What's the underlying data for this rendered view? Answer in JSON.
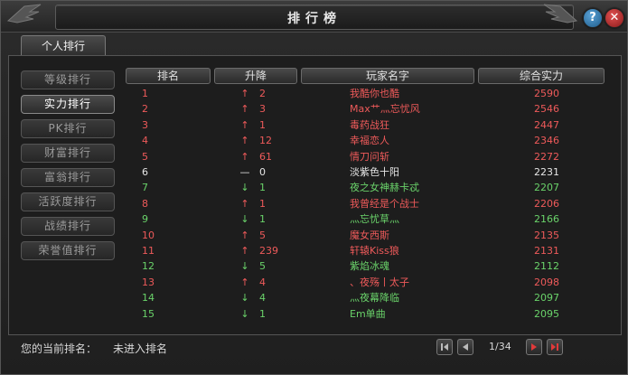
{
  "window": {
    "title": "排行榜"
  },
  "tabs": [
    {
      "label": "个人排行"
    }
  ],
  "menu": [
    {
      "label": "等级排行",
      "active": false
    },
    {
      "label": "实力排行",
      "active": true
    },
    {
      "label": "PK排行",
      "active": false
    },
    {
      "label": "财富排行",
      "active": false
    },
    {
      "label": "富翁排行",
      "active": false
    },
    {
      "label": "活跃度排行",
      "active": false
    },
    {
      "label": "战绩排行",
      "active": false
    },
    {
      "label": "荣誉值排行",
      "active": false
    }
  ],
  "table": {
    "columns": [
      "排名",
      "升降",
      "玩家名字",
      "综合实力"
    ],
    "rows": [
      {
        "rank": "1",
        "arrow": "↑",
        "change": "2",
        "name": "我酷你也酷",
        "power": "2590",
        "color": "red"
      },
      {
        "rank": "2",
        "arrow": "↑",
        "change": "3",
        "name": "Max艹灬忘忧风",
        "power": "2546",
        "color": "red"
      },
      {
        "rank": "3",
        "arrow": "↑",
        "change": "1",
        "name": "毒药战狂",
        "power": "2447",
        "color": "red"
      },
      {
        "rank": "4",
        "arrow": "↑",
        "change": "12",
        "name": "幸福恋人",
        "power": "2346",
        "color": "red"
      },
      {
        "rank": "5",
        "arrow": "↑",
        "change": "61",
        "name": "情刀问斩",
        "power": "2272",
        "color": "red"
      },
      {
        "rank": "6",
        "arrow": "—",
        "change": "0",
        "name": "淡紫色十阳",
        "power": "2231",
        "color": "white"
      },
      {
        "rank": "7",
        "arrow": "↓",
        "change": "1",
        "name": "夜之女神赫卡忒",
        "power": "2207",
        "color": "green"
      },
      {
        "rank": "8",
        "arrow": "↑",
        "change": "1",
        "name": "我曾经是个战士",
        "power": "2206",
        "color": "red"
      },
      {
        "rank": "9",
        "arrow": "↓",
        "change": "1",
        "name": "灬忘忧草灬",
        "power": "2166",
        "color": "green"
      },
      {
        "rank": "10",
        "arrow": "↑",
        "change": "5",
        "name": "魔女西斯",
        "power": "2135",
        "color": "red"
      },
      {
        "rank": "11",
        "arrow": "↑",
        "change": "239",
        "name": "轩辕Kiss狼",
        "power": "2131",
        "color": "red"
      },
      {
        "rank": "12",
        "arrow": "↓",
        "change": "5",
        "name": "紫焰冰魂",
        "power": "2112",
        "color": "green"
      },
      {
        "rank": "13",
        "arrow": "↑",
        "change": "4",
        "name": "、夜殇丨太子",
        "power": "2098",
        "color": "red"
      },
      {
        "rank": "14",
        "arrow": "↓",
        "change": "4",
        "name": "灬夜幕降临",
        "power": "2097",
        "color": "green"
      },
      {
        "rank": "15",
        "arrow": "↓",
        "change": "1",
        "name": "Em单曲",
        "power": "2095",
        "color": "green"
      }
    ]
  },
  "footer": {
    "my_rank_label": "您的当前排名：",
    "my_rank_value": "未进入排名",
    "page": "1/34"
  },
  "icons": {
    "help": "help-icon",
    "close": "close-icon",
    "first": "first-page-icon",
    "prev": "prev-page-icon",
    "next": "next-page-icon",
    "last": "last-page-icon"
  },
  "colors": {
    "up": "#ee5a5a",
    "same": "#e6e6e6",
    "down": "#6ad36a"
  }
}
